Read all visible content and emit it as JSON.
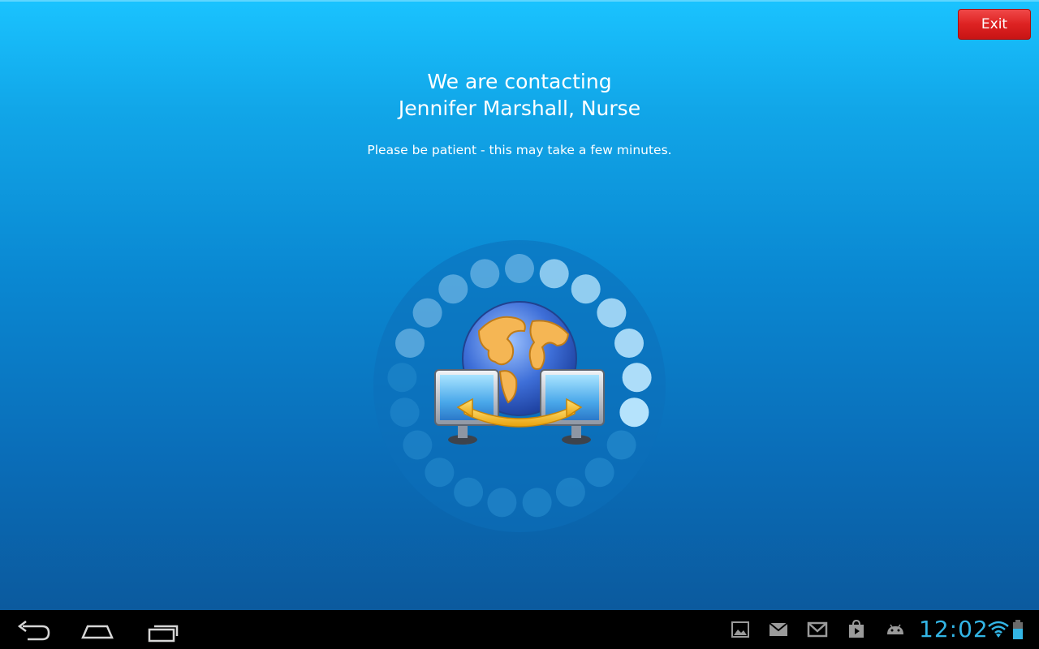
{
  "app": {
    "exit_label": "Exit",
    "heading_line1": "We are contacting",
    "heading_line2": "Jennifer Marshall, Nurse",
    "subtext": "Please be patient - this may take a few minutes.",
    "illustration": "globe-with-two-monitors-icon"
  },
  "colors": {
    "accent": "#1ac3ff",
    "background_bottom": "#0b5a9e",
    "exit_button": "#dd2222",
    "clock": "#33b5e5",
    "navbar": "#000000"
  },
  "system_bar": {
    "nav_icons": [
      "back-icon",
      "home-icon",
      "recent-apps-icon"
    ],
    "notification_icons": [
      "gallery-icon",
      "email-icon",
      "gmail-icon",
      "play-store-icon",
      "android-debug-icon"
    ],
    "clock": "12:02",
    "status_icons": [
      "wifi-icon",
      "battery-icon"
    ]
  }
}
